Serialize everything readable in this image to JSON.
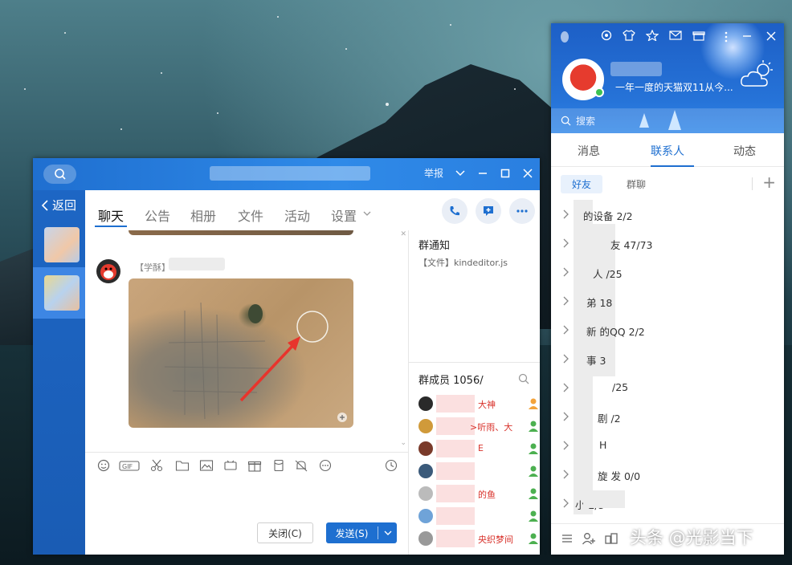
{
  "chat_window": {
    "title_actions": {
      "report": "举报"
    },
    "sidebar": {
      "back_label": "返回"
    },
    "tabs": [
      {
        "label": "聊天",
        "active": true
      },
      {
        "label": "公告"
      },
      {
        "label": "相册"
      },
      {
        "label": "文件"
      },
      {
        "label": "活动"
      },
      {
        "label": "设置"
      }
    ],
    "message": {
      "sender_tag": "【学酥】"
    },
    "group_notice": {
      "title": "群通知",
      "body": "【文件】kindeditor.js"
    },
    "members": {
      "title": "群成员 1056/",
      "rows": [
        {
          "name": "大神"
        },
        {
          "name": ">听雨、大"
        },
        {
          "name": "E"
        },
        {
          "name": ""
        },
        {
          "name": "的鱼"
        },
        {
          "name": ""
        },
        {
          "name": "央织梦间"
        }
      ]
    },
    "buttons": {
      "close": "关闭(C)",
      "send": "发送(S)"
    }
  },
  "qq_panel": {
    "signature": "一年一度的天猫双11从今...",
    "search_placeholder": "搜索",
    "tabs": [
      {
        "label": "消息"
      },
      {
        "label": "联系人",
        "active": true
      },
      {
        "label": "动态"
      }
    ],
    "sub_tabs": [
      {
        "label": "好友",
        "active": true
      },
      {
        "label": "群聊"
      }
    ],
    "groups": [
      {
        "label": "的设备 2/2"
      },
      {
        "label": "友 47/73"
      },
      {
        "label": "人 /25"
      },
      {
        "label": "弟 18"
      },
      {
        "label": "新 的QQ 2/2"
      },
      {
        "label": "事 3"
      },
      {
        "label": "/25"
      },
      {
        "label": "剧 /2"
      },
      {
        "label": "H"
      },
      {
        "label": "旋 发 0/0"
      },
      {
        "label": "小 2/3"
      }
    ]
  },
  "watermark": "头条 @光影当下",
  "colors": {
    "accent": "#1e6fd0",
    "titlebar": "#2f8ae8",
    "member_red": "#d8312a"
  }
}
